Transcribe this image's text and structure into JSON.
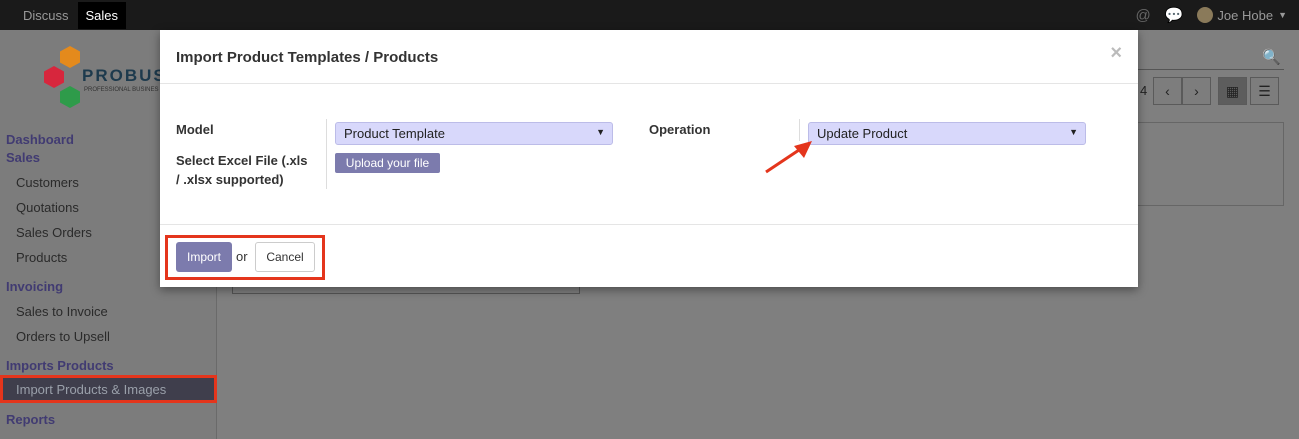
{
  "topbar": {
    "menu": [
      "Discuss",
      "Sales"
    ],
    "active": "Sales",
    "user_name": "Joe Hobe"
  },
  "logo": {
    "text": "PROBUS",
    "subtext": "PROFESSIONAL BUSINES"
  },
  "sidebar": {
    "dashboard": "Dashboard",
    "sales_head": "Sales",
    "sales_items": [
      "Customers",
      "Quotations",
      "Sales Orders",
      "Products"
    ],
    "invoicing_head": "Invoicing",
    "invoicing_items": [
      "Sales to Invoice",
      "Orders to Upsell"
    ],
    "imports_head": "Imports Products",
    "imports_items": [
      "Import Products & Images"
    ],
    "reports_head": "Reports"
  },
  "background": {
    "pager_value": "4"
  },
  "modal": {
    "title": "Import Product Templates / Products",
    "model_label": "Model",
    "model_value": "Product Template",
    "file_label_line1": "Select Excel File (.xls",
    "file_label_line2": "/ .xlsx supported)",
    "upload_label": "Upload your file",
    "operation_label": "Operation",
    "operation_value": "Update Product",
    "import_label": "Import",
    "or_label": "or",
    "cancel_label": "Cancel",
    "close_label": "×"
  },
  "colors": {
    "accent": "#7c7bad",
    "highlight": "#e4351c",
    "select_bg": "#d8d8fb"
  }
}
